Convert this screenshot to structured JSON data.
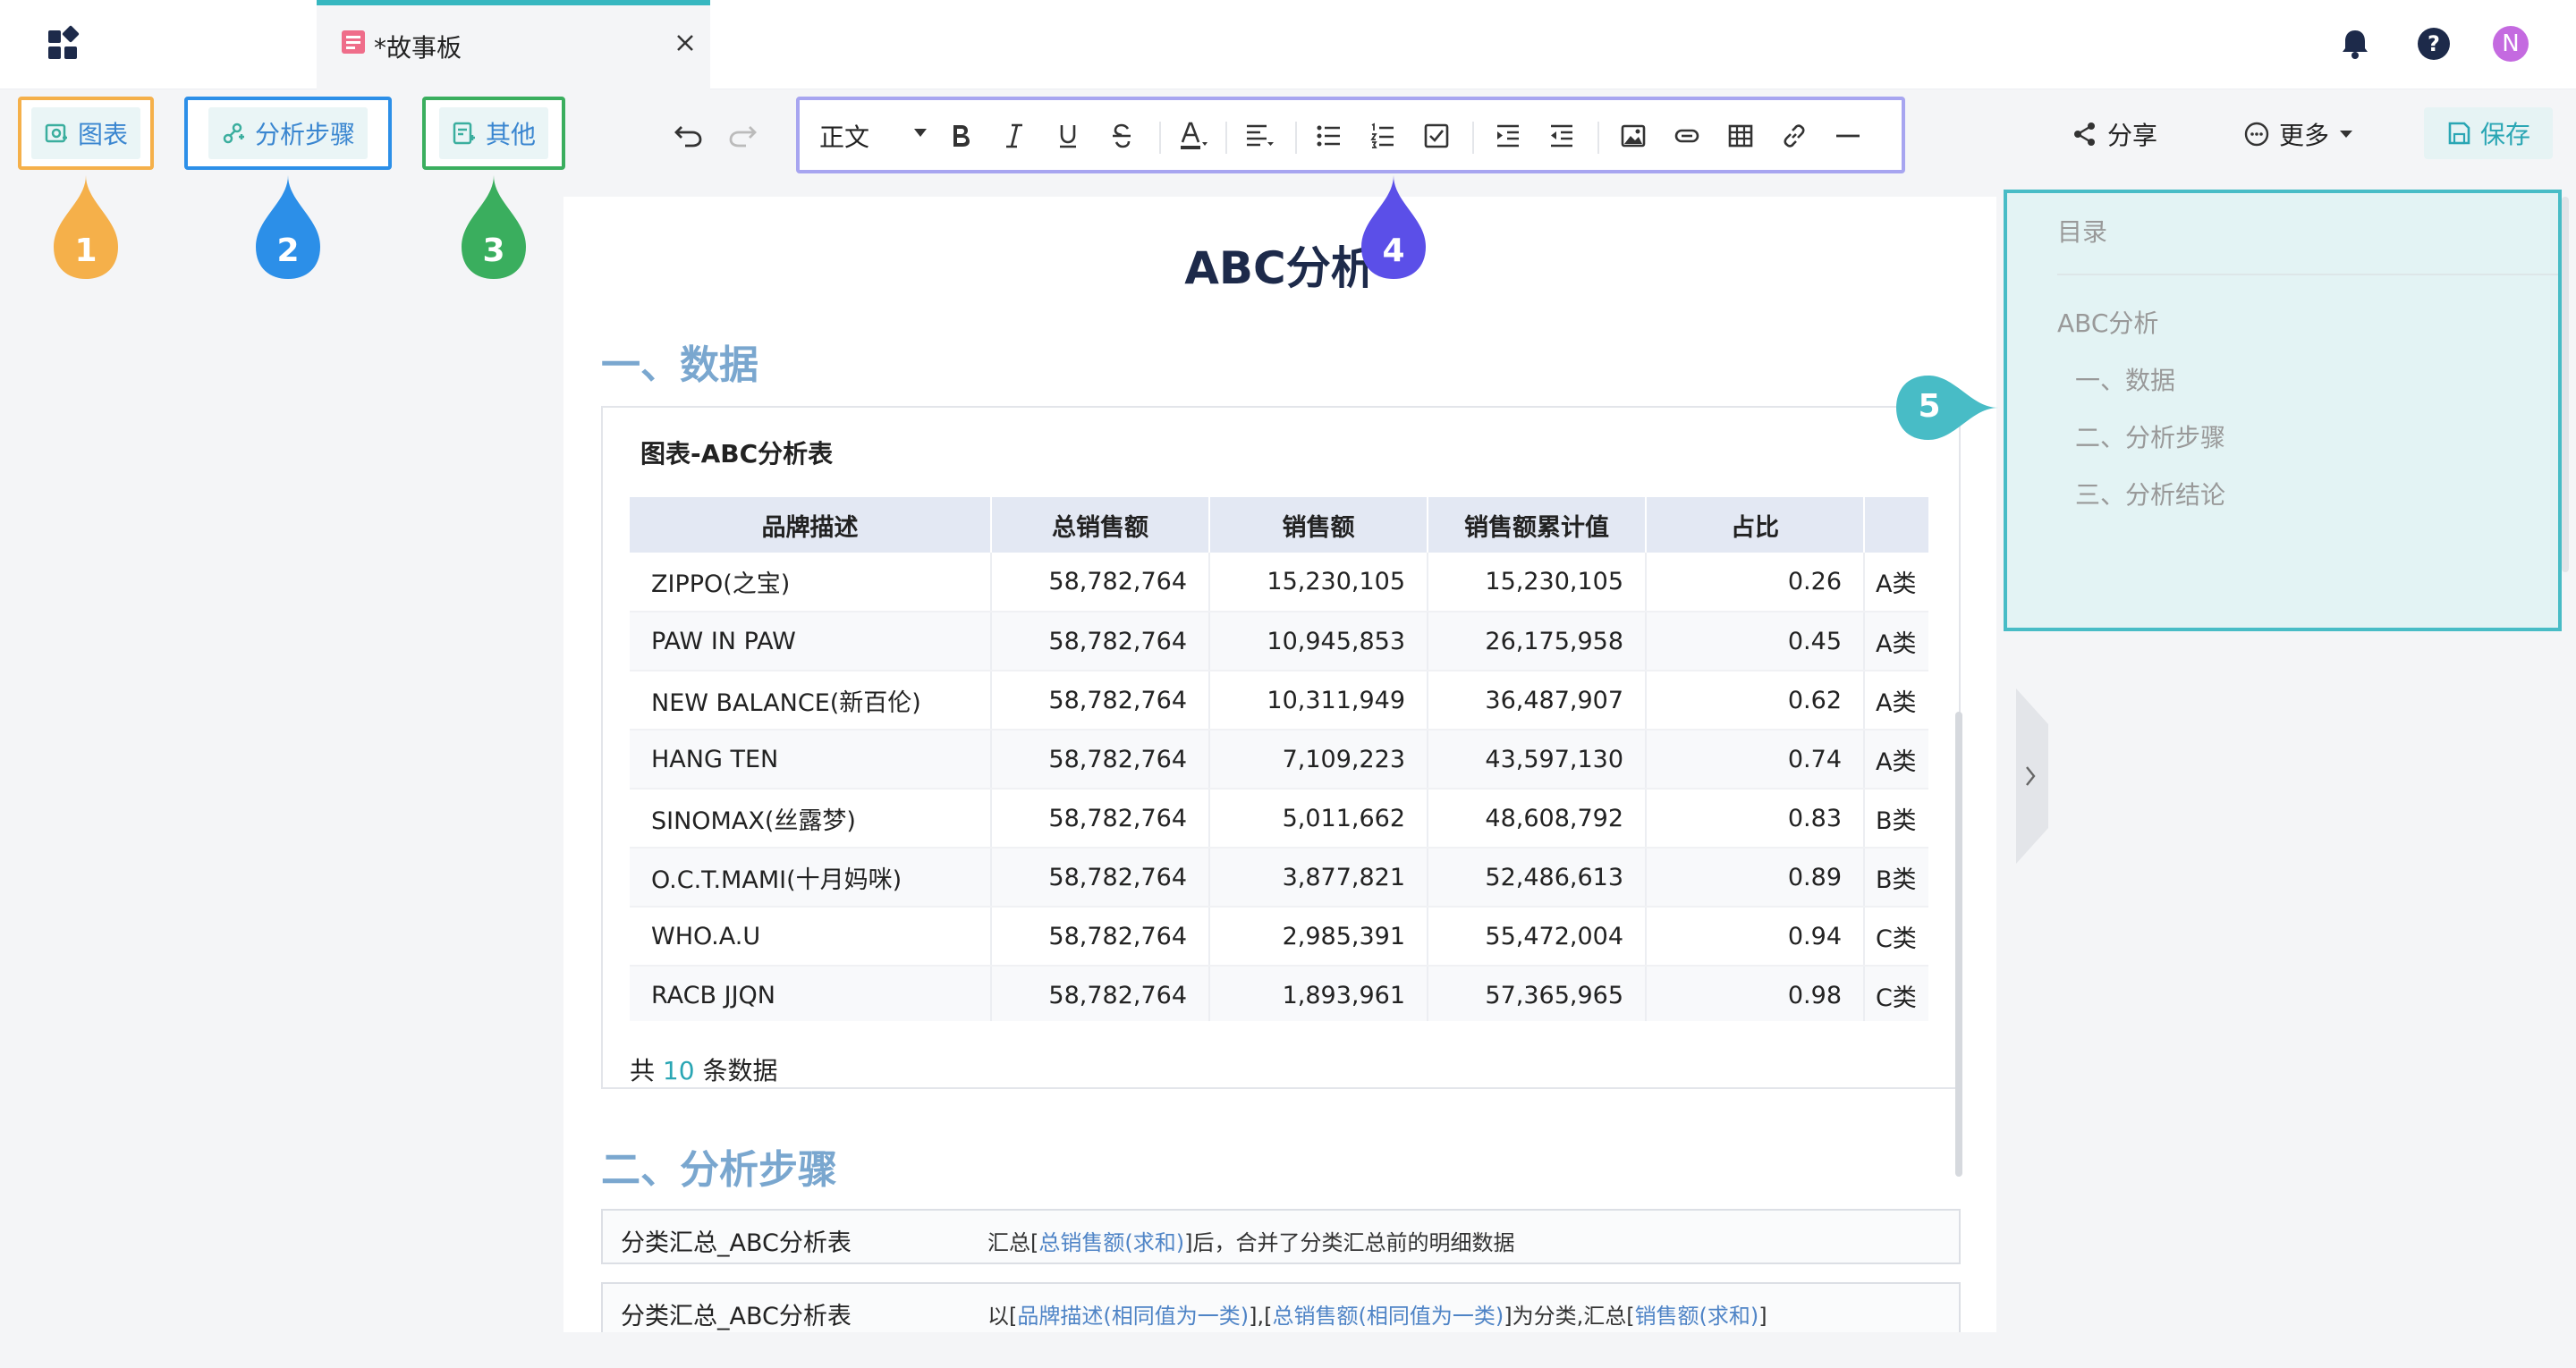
{
  "tab": {
    "title": "*故事板",
    "close": "×"
  },
  "toolbar": {
    "chart_label": "图表",
    "steps_label": "分析步骤",
    "other_label": "其他",
    "text_style": "正文",
    "share_label": "分享",
    "more_label": "更多",
    "save_label": "保存",
    "avatar_initial": "N"
  },
  "markers": [
    "1",
    "2",
    "3",
    "4",
    "5"
  ],
  "marker_colors": [
    "#f5b04a",
    "#2c8fe8",
    "#3aae5e",
    "#5b4fe8",
    "#48bcc6"
  ],
  "doc": {
    "title": "ABC分析",
    "section1": "一、数据",
    "section2": "二、分析步骤"
  },
  "chart_card": {
    "title": "图表-ABC分析表",
    "columns": [
      "品牌描述",
      "总销售额",
      "销售额",
      "销售额累计值",
      "占比",
      ""
    ],
    "rows": [
      [
        "ZIPPO(之宝)",
        "58,782,764",
        "15,230,105",
        "15,230,105",
        "0.26",
        "A类"
      ],
      [
        "PAW IN PAW",
        "58,782,764",
        "10,945,853",
        "26,175,958",
        "0.45",
        "A类"
      ],
      [
        "NEW BALANCE(新百伦)",
        "58,782,764",
        "10,311,949",
        "36,487,907",
        "0.62",
        "A类"
      ],
      [
        "HANG TEN",
        "58,782,764",
        "7,109,223",
        "43,597,130",
        "0.74",
        "A类"
      ],
      [
        "SINOMAX(丝露梦)",
        "58,782,764",
        "5,011,662",
        "48,608,792",
        "0.83",
        "B类"
      ],
      [
        "O.C.T.MAMI(十月妈咪)",
        "58,782,764",
        "3,877,821",
        "52,486,613",
        "0.89",
        "B类"
      ],
      [
        "WHO.A.U",
        "58,782,764",
        "2,985,391",
        "55,472,004",
        "0.94",
        "C类"
      ],
      [
        "RACB JJQN",
        "58,782,764",
        "1,893,961",
        "57,365,965",
        "0.98",
        "C类"
      ]
    ],
    "total_prefix": "共",
    "total_count": "10",
    "total_suffix": "条数据"
  },
  "steps": [
    {
      "name": "分类汇总_ABC分析表",
      "d1": "汇总[",
      "h1": "总销售额(求和)",
      "d2": "]后，合并了分类汇总前的明细数据",
      "h2": "",
      "d3": "",
      "h3": "",
      "d4": ""
    },
    {
      "name": "分类汇总_ABC分析表",
      "d1": "以[",
      "h1": "品牌描述(相同值为一类)",
      "d2": "],[",
      "h2": "总销售额(相同值为一类)",
      "d3": "]为分类,汇总[",
      "h3": "销售额(求和)",
      "d4": "]"
    }
  ],
  "toc": {
    "title": "目录",
    "items": [
      "ABC分析",
      "一、数据",
      "二、分析步骤",
      "三、分析结论"
    ]
  }
}
